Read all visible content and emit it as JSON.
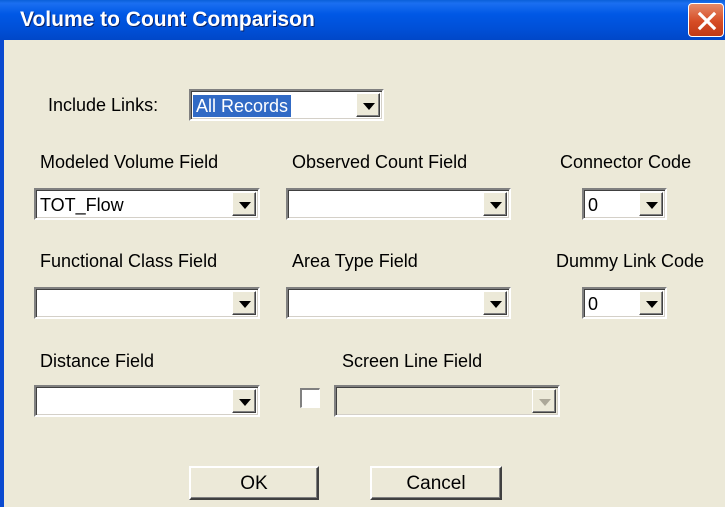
{
  "window": {
    "title": "Volume to Count Comparison",
    "close_icon": "close-icon"
  },
  "include_links": {
    "label": "Include Links:",
    "value": "All Records"
  },
  "fields": {
    "modeled_volume": {
      "label": "Modeled Volume Field",
      "value": "TOT_Flow"
    },
    "observed_count": {
      "label": "Observed Count Field",
      "value": ""
    },
    "connector_code": {
      "label": "Connector Code",
      "value": "0"
    },
    "functional_class": {
      "label": "Functional Class Field",
      "value": ""
    },
    "area_type": {
      "label": "Area Type Field",
      "value": ""
    },
    "dummy_link_code": {
      "label": "Dummy Link Code",
      "value": "0"
    },
    "distance": {
      "label": "Distance Field",
      "value": ""
    },
    "screen_line": {
      "label": "Screen Line Field",
      "value": "",
      "enabled": false,
      "checked": false
    }
  },
  "buttons": {
    "ok": "OK",
    "cancel": "Cancel"
  },
  "colors": {
    "titlebar": "#0054e3",
    "dialog_bg": "#ece9d8",
    "selection": "#316ac5",
    "close_button": "#d64c25"
  }
}
